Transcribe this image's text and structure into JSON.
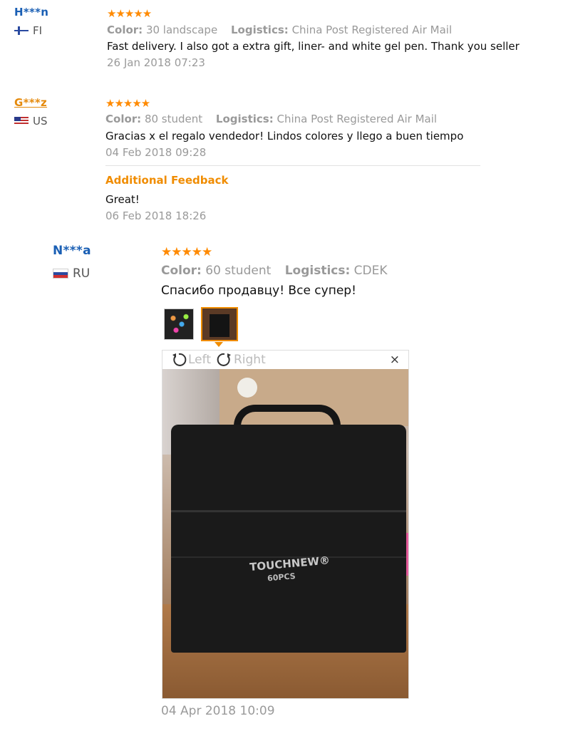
{
  "reviews": [
    {
      "user": "H***n",
      "country": "FI",
      "stars": "★★★★★",
      "color_label": "Color:",
      "color_value": "30 landscape",
      "logistics_label": "Logistics:",
      "logistics_value": "China Post Registered Air Mail",
      "text": "Fast delivery. I also got a extra gift, liner- and white gel pen. Thank you seller",
      "date": "26 Jan 2018 07:23"
    },
    {
      "user": "G***z",
      "country": "US",
      "stars": "★★★★★",
      "color_label": "Color:",
      "color_value": "80 student",
      "logistics_label": "Logistics:",
      "logistics_value": "China Post Registered Air Mail",
      "text": "Gracias x el regalo vendedor! Lindos colores y llego a buen tiempo",
      "date": "04 Feb 2018 09:28",
      "additional_label": "Additional Feedback",
      "additional_text": "Great!",
      "additional_date": "06 Feb 2018 18:26"
    },
    {
      "user": "N***a",
      "country": "RU",
      "stars": "★★★★★",
      "color_label": "Color:",
      "color_value": "60 student",
      "logistics_label": "Logistics:",
      "logistics_value": "CDEK",
      "text": "Спасибо продавцу! Все супер!",
      "date": "04 Apr 2018 10:09"
    }
  ],
  "viewer": {
    "left_label": "Left",
    "right_label": "Right",
    "close_label": "×",
    "product_brand": "TOUCHNEW®",
    "product_count": "60PCS"
  },
  "colors": {
    "star": "#ff8a00",
    "username": "#1a5fb4",
    "highlight": "#f08c00"
  }
}
